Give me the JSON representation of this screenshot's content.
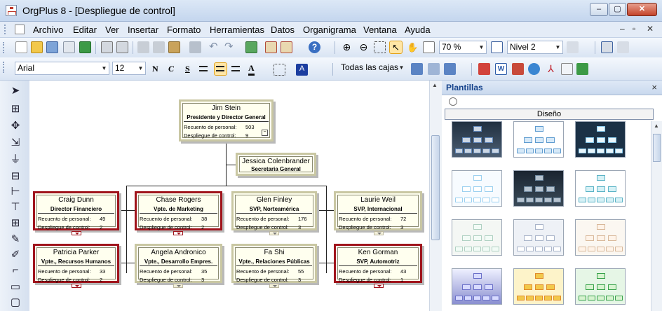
{
  "window": {
    "title": "OrgPlus 8 - [Despliegue de control]"
  },
  "menu": [
    "Archivo",
    "Editar",
    "Ver",
    "Insertar",
    "Formato",
    "Herramientas",
    "Datos",
    "Organigrama",
    "Ventana",
    "Ayuda"
  ],
  "toolbar": {
    "zoom": "70 %",
    "level": "Nivel 2"
  },
  "format": {
    "font": "Arial",
    "size": "12",
    "bold": "N",
    "italic": "C",
    "underline": "S",
    "strike": "S",
    "font_color_label": "A",
    "scope": "Todas las cajas"
  },
  "panel": {
    "title": "Plantillas",
    "tab": "Diseño",
    "close": "×"
  },
  "labels": {
    "count": "Recuento de personal:",
    "span": "Despliegue de control:"
  },
  "chart": {
    "boxes": [
      {
        "id": "jim",
        "name": "Jim Stein",
        "role": "Presidente y Director General",
        "count": "503",
        "span": "9"
      },
      {
        "id": "jessica",
        "name": "Jessica Colenbrander",
        "role": "Secretaria General"
      },
      {
        "id": "craig",
        "name": "Craig Dunn",
        "role": "Director Financiero",
        "count": "49",
        "span": "2"
      },
      {
        "id": "chase",
        "name": "Chase Rogers",
        "role": "Vpte. de Marketing",
        "count": "38",
        "span": "2"
      },
      {
        "id": "glen",
        "name": "Glen Finley",
        "role": "SVP, Norteamérica",
        "count": "176",
        "span": "3"
      },
      {
        "id": "laurie",
        "name": "Laurie Weil",
        "role": "SVP, Internacional",
        "count": "72",
        "span": "3"
      },
      {
        "id": "patricia",
        "name": "Patricia Parker",
        "role": "Vpte., Recursos Humanos",
        "count": "33",
        "span": "2"
      },
      {
        "id": "angela",
        "name": "Angela Andronico",
        "role": "Vpte., Desarrollo Empres.",
        "count": "35",
        "span": "3"
      },
      {
        "id": "fa",
        "name": "Fa Shi",
        "role": "Vpte., Relaciones Públicas",
        "count": "55",
        "span": "3"
      },
      {
        "id": "ken",
        "name": "Ken Gorman",
        "role": "SVP, Automotriz",
        "count": "43",
        "span": "1"
      }
    ]
  }
}
